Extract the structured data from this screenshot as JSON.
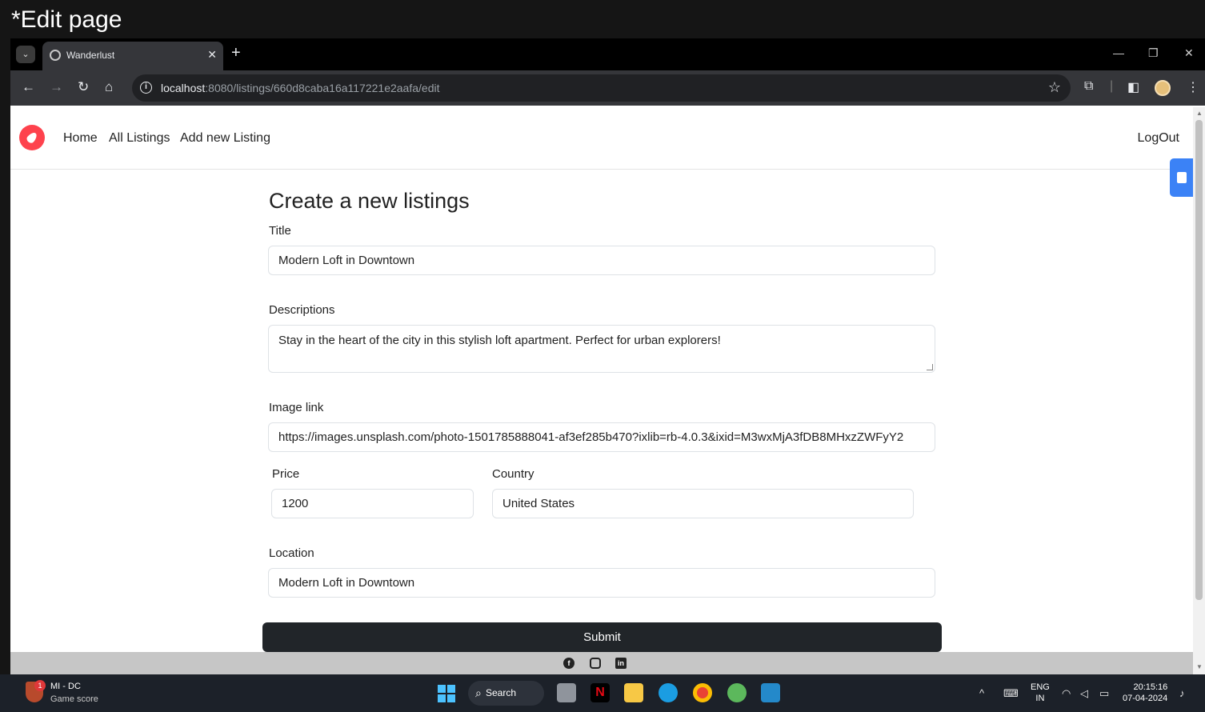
{
  "caption": "*Edit page",
  "browser": {
    "tab_title": "Wanderlust",
    "url_host": "localhost",
    "url_rest": ":8080/listings/660d8caba16a117221e2aafa/edit"
  },
  "site": {
    "nav": {
      "home": "Home",
      "all_listings": "All Listings",
      "add_new": "Add new Listing",
      "logout": "LogOut"
    },
    "form": {
      "heading": "Create a new listings",
      "title_label": "Title",
      "title_value": "Modern Loft in Downtown",
      "description_label": "Descriptions",
      "description_value": "Stay in the heart of the city in this stylish loft apartment. Perfect for urban explorers!",
      "image_label": "Image link",
      "image_value": "https://images.unsplash.com/photo-1501785888041-af3ef285b470?ixlib=rb-4.0.3&ixid=M3wxMjA3fDB8MHxzZWFyY2",
      "price_label": "Price",
      "price_value": "1200",
      "country_label": "Country",
      "country_value": "United States",
      "location_label": "Location",
      "location_value": "Modern Loft in Downtown",
      "submit_label": "Submit"
    },
    "footer_icons": [
      "facebook-icon",
      "instagram-icon",
      "linkedin-icon"
    ]
  },
  "taskbar": {
    "game_badge": "1",
    "game_title": "MI - DC",
    "game_subtitle": "Game score",
    "search_label": "Search",
    "lang_top": "ENG",
    "lang_bottom": "IN",
    "time": "20:15:16",
    "date": "07-04-2024"
  },
  "colors": {
    "brand": "#fe424d",
    "submit_bg": "#212529",
    "footer_bg": "#c6c6c6",
    "taskbar_bg": "#1c2129"
  }
}
